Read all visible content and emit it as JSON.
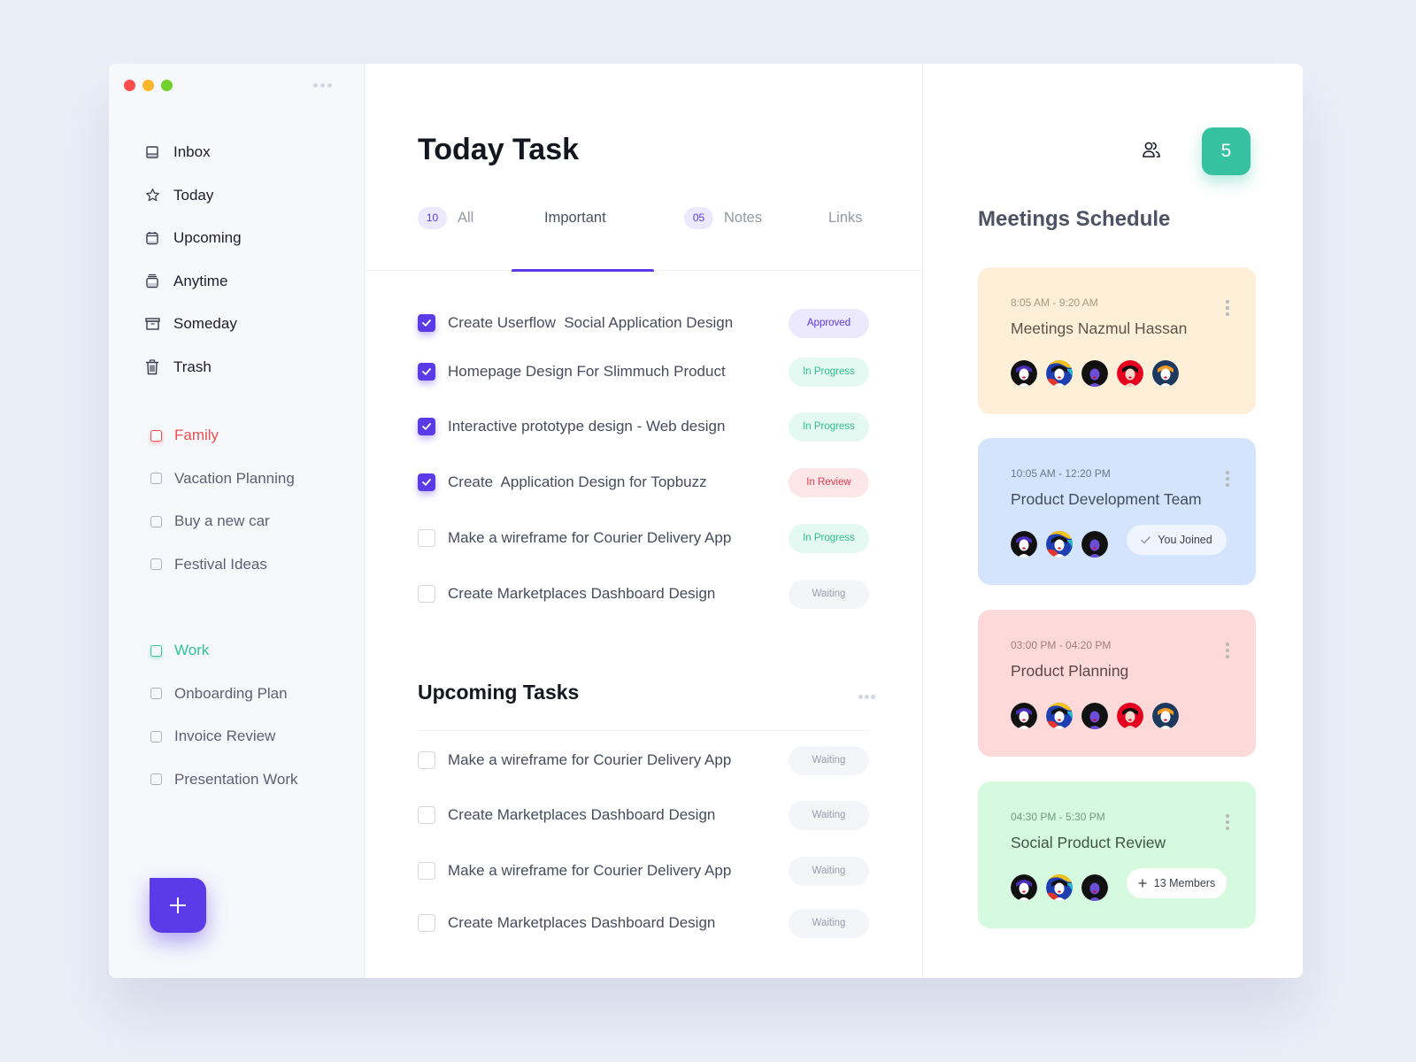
{
  "window": {
    "controls": [
      "close",
      "minimize",
      "maximize"
    ]
  },
  "sidebar": {
    "nav": [
      {
        "label": "Inbox",
        "icon": "inbox-icon"
      },
      {
        "label": "Today",
        "icon": "star-icon"
      },
      {
        "label": "Upcoming",
        "icon": "calendar-icon"
      },
      {
        "label": "Anytime",
        "icon": "stack-icon"
      },
      {
        "label": "Someday",
        "icon": "archive-icon"
      },
      {
        "label": "Trash",
        "icon": "trash-icon"
      }
    ],
    "groups": [
      {
        "label": "Family",
        "color": "#f04e4e",
        "items": [
          "Vacation Planning",
          "Buy a new car",
          "Festival Ideas"
        ]
      },
      {
        "label": "Work",
        "color": "#2fc59c",
        "items": [
          "Onboarding Plan",
          "Invoice Review",
          "Presentation Work"
        ]
      }
    ],
    "fab_icon": "plus-icon"
  },
  "main": {
    "title": "Today Task",
    "tabs": [
      {
        "label": "All",
        "count": "10",
        "active": false
      },
      {
        "label": "Important",
        "count": null,
        "active": true
      },
      {
        "label": "Notes",
        "count": "05",
        "active": false
      },
      {
        "label": "Links",
        "count": null,
        "active": false
      }
    ],
    "tasks": [
      {
        "label": "Create Userflow  Social Application Design",
        "checked": true,
        "status": "Approved"
      },
      {
        "label": "Homepage Design For Slimmuch Product",
        "checked": true,
        "status": "In Progress"
      },
      {
        "label": "Interactive prototype design - Web design",
        "checked": true,
        "status": "In Progress"
      },
      {
        "label": "Create  Application Design for Topbuzz",
        "checked": true,
        "status": "In Review"
      },
      {
        "label": "Make a wireframe for Courier Delivery App",
        "checked": false,
        "status": "In Progress"
      },
      {
        "label": "Create Marketplaces Dashboard Design",
        "checked": false,
        "status": "Waiting"
      }
    ],
    "upcoming": {
      "title": "Upcoming Tasks",
      "tasks": [
        {
          "label": "Make a wireframe for Courier Delivery App",
          "checked": false,
          "status": "Waiting"
        },
        {
          "label": "Create Marketplaces Dashboard Design",
          "checked": false,
          "status": "Waiting"
        },
        {
          "label": "Make a wireframe for Courier Delivery App",
          "checked": false,
          "status": "Waiting"
        },
        {
          "label": "Create Marketplaces Dashboard Design",
          "checked": false,
          "status": "Waiting"
        }
      ]
    },
    "status_colors": {
      "Approved": {
        "bg": "#ece8fd",
        "fg": "#5b3be8"
      },
      "In Progress": {
        "bg": "#e3f9f1",
        "fg": "#2fbf8f"
      },
      "In Review": {
        "bg": "#fde6e8",
        "fg": "#e8394d"
      },
      "Waiting": {
        "bg": "#f4f5f9",
        "fg": "#9a9dab"
      }
    },
    "accent": "#5b3be8"
  },
  "right": {
    "people_icon": "users-icon",
    "notification_count": "5",
    "title": "Meetings Schedule",
    "meetings": [
      {
        "time": "8:05 AM - 9:20 AM",
        "title": "Meetings Nazmul Hassan",
        "bg": "#fef0d8",
        "time_color": "#a39a85",
        "title_color": "#5b5447",
        "avatars": 5,
        "pill": null
      },
      {
        "time": "10:05 AM - 12:20 PM",
        "title": "Product Development Team",
        "bg": "#d3e4fc",
        "time_color": "#6d7989",
        "title_color": "#444d5c",
        "avatars": 3,
        "pill": {
          "label": "You Joined",
          "icon": "check-icon"
        }
      },
      {
        "time": "03:00 PM - 04:20 PM",
        "title": "Product Planning",
        "bg": "#fdd9da",
        "time_color": "#a37c7e",
        "title_color": "#5e4647",
        "avatars": 5,
        "pill": null
      },
      {
        "time": "04:30 PM - 5:30 PM",
        "title": "Social Product Review",
        "bg": "#d6fadf",
        "time_color": "#6f9c80",
        "title_color": "#3f5548",
        "avatars": 3,
        "pill": {
          "label": "13 Members",
          "icon": "plus-icon"
        }
      }
    ]
  }
}
